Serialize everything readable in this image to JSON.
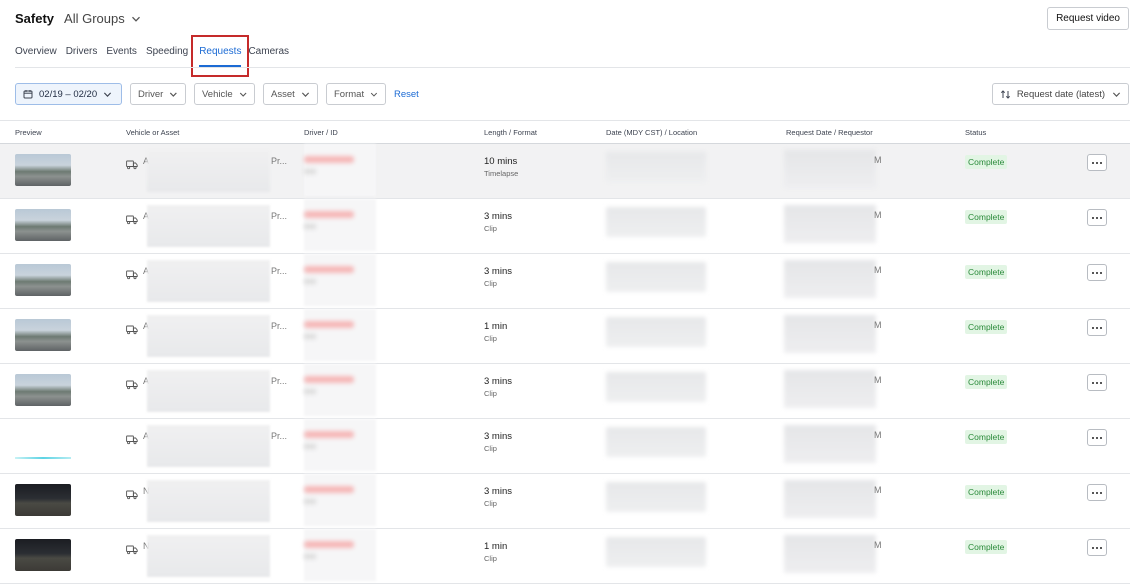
{
  "header": {
    "title": "Safety",
    "group_label": "All Groups",
    "request_video_label": "Request video"
  },
  "tabs": [
    {
      "label": "Overview"
    },
    {
      "label": "Drivers"
    },
    {
      "label": "Events"
    },
    {
      "label": "Speeding"
    },
    {
      "label": "Requests",
      "active": true
    },
    {
      "label": "Cameras"
    }
  ],
  "filters": {
    "date_range": "02/19 – 02/20",
    "driver": "Driver",
    "vehicle": "Vehicle",
    "asset": "Asset",
    "format": "Format",
    "reset": "Reset",
    "sort": "Request date (latest)"
  },
  "table": {
    "columns": [
      "Preview",
      "Vehicle or Asset",
      "Driver / ID",
      "Length / Format",
      "Date (MDY CST) / Location",
      "Request Date / Requestor",
      "Status"
    ],
    "rows": [
      {
        "vehicle_prefix": "A",
        "vehicle_suffix": "Pr...",
        "length": "10 mins",
        "format": "Timelapse",
        "req_suffix": "M",
        "status": "Complete",
        "thumb": "day"
      },
      {
        "vehicle_prefix": "A",
        "vehicle_suffix": "Pr...",
        "length": "3 mins",
        "format": "Clip",
        "req_suffix": "M",
        "status": "Complete",
        "thumb": "day"
      },
      {
        "vehicle_prefix": "A",
        "vehicle_suffix": "Pr...",
        "length": "3 mins",
        "format": "Clip",
        "req_suffix": "M",
        "status": "Complete",
        "thumb": "day"
      },
      {
        "vehicle_prefix": "A",
        "vehicle_suffix": "Pr...",
        "length": "1 min",
        "format": "Clip",
        "req_suffix": "M",
        "status": "Complete",
        "thumb": "day"
      },
      {
        "vehicle_prefix": "A",
        "vehicle_suffix": "Pr...",
        "length": "3 mins",
        "format": "Clip",
        "req_suffix": "M",
        "status": "Complete",
        "thumb": "day"
      },
      {
        "vehicle_prefix": "A",
        "vehicle_suffix": "Pr...",
        "length": "3 mins",
        "format": "Clip",
        "req_suffix": "M",
        "status": "Complete",
        "thumb": "blank"
      },
      {
        "vehicle_prefix": "N",
        "vehicle_suffix": "",
        "length": "3 mins",
        "format": "Clip",
        "req_suffix": "M",
        "status": "Complete",
        "thumb": "night"
      },
      {
        "vehicle_prefix": "N",
        "vehicle_suffix": "",
        "length": "1 min",
        "format": "Clip",
        "req_suffix": "M",
        "status": "Complete",
        "thumb": "night"
      }
    ]
  },
  "colors": {
    "accent": "#1c6bd4",
    "status_bg": "#e2f5e4",
    "status_text": "#2a8a3a",
    "highlight": "#c52a2a"
  },
  "icons": {
    "group_chevron": "chevron-down-icon",
    "calendar": "calendar-icon",
    "sort": "sort-icon",
    "vehicle": "truck-icon",
    "more": "more-horizontal-icon"
  }
}
